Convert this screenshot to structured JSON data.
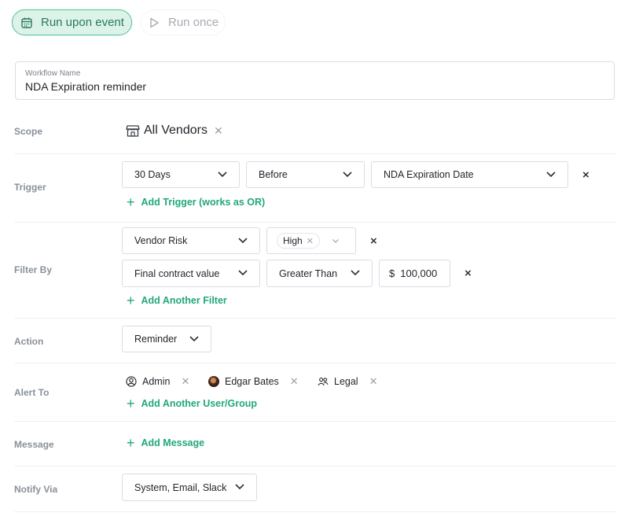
{
  "mode": {
    "active_label": "Run upon event",
    "active_icon": "calendar-icon",
    "inactive_label": "Run once",
    "inactive_icon": "play-icon"
  },
  "workflow": {
    "label": "Workflow Name",
    "value": "NDA Expiration reminder"
  },
  "rows": {
    "scope": "Scope",
    "trigger": "Trigger",
    "filter": "Filter By",
    "action": "Action",
    "alert": "Alert To",
    "message": "Message",
    "notify": "Notify Via"
  },
  "scope": {
    "icon": "store-icon",
    "value": "All Vendors"
  },
  "trigger": {
    "period": "30 Days",
    "relation": "Before",
    "field": "NDA Expiration Date",
    "add_label": "Add Trigger (works as OR)"
  },
  "filters": {
    "f1_field": "Vendor Risk",
    "f1_chip": "High",
    "f2_field": "Final contract value",
    "f2_operator": "Greater Than",
    "f2_currency": "$",
    "f2_value": "100,000",
    "add_label": "Add Another Filter"
  },
  "action": {
    "value": "Reminder"
  },
  "alert": {
    "users": [
      {
        "name": "Admin",
        "icon": "user-circle-icon"
      },
      {
        "name": "Edgar Bates",
        "icon": "avatar"
      },
      {
        "name": "Legal",
        "icon": "group-icon"
      }
    ],
    "add_label": "Add Another User/Group"
  },
  "message": {
    "add_label": "Add Message"
  },
  "notify": {
    "value": "System, Email, Slack"
  },
  "colors": {
    "accent": "#21a77b",
    "active_bg": "#dcf3e9",
    "active_border": "#5cc39a"
  }
}
